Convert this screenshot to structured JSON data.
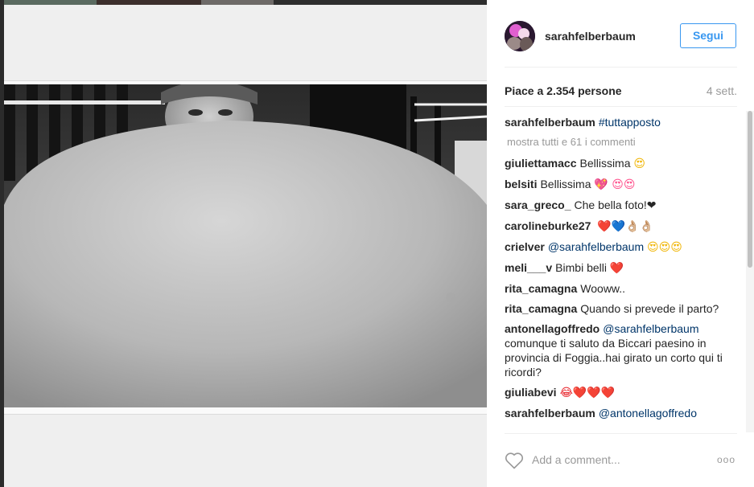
{
  "post": {
    "photo_alt": "Black and white photo",
    "author": "sarahfelberbaum",
    "follow_label": "Segui",
    "likes_text": "Piace a 2.354 persone",
    "time": "4 sett.",
    "caption": {
      "user": "sarahfelberbaum",
      "text": "#tuttapposto"
    },
    "load_more": "mostra tutti e 61 i commenti"
  },
  "comments": [
    {
      "user": "giuliettamacc",
      "text": "Bellissima",
      "emoji": "😍"
    },
    {
      "user": "belsiti",
      "text": "Bellissima",
      "emoji": "💖 😍😍"
    },
    {
      "user": "sara_greco_",
      "text": "Che bella foto!❤",
      "emoji": ""
    },
    {
      "user": "carolineburke27",
      "text": "",
      "emoji": "❤️💙👌🏼👌🏼"
    },
    {
      "user": "crielver",
      "mention": "@sarahfelberbaum",
      "text": "",
      "emoji": "😍😍😍"
    },
    {
      "user": "meli___v",
      "text": "Bimbi belli",
      "emoji": "❤️"
    },
    {
      "user": "rita_camagna",
      "text": "Wooww..",
      "emoji": ""
    },
    {
      "user": "rita_camagna",
      "text": "Quando si prevede il parto?",
      "emoji": ""
    },
    {
      "user": "antonellagoffredo",
      "mention": "@sarahfelberbaum",
      "text": "comunque ti saluto da Biccari paesino in provincia di Foggia..hai girato un corto qui ti ricordi?",
      "emoji": ""
    },
    {
      "user": "giuliabevi",
      "text": "",
      "emoji": "😂❤️❤️❤️"
    },
    {
      "user": "sarahfelberbaum",
      "mention": "@antonellagoffredo",
      "text": "",
      "emoji": ""
    }
  ],
  "footer": {
    "comment_placeholder": "Add a comment...",
    "more_label": "ooo"
  },
  "icons": {
    "like": "heart-outline-icon",
    "more": "ellipsis-icon"
  },
  "colors": {
    "accent": "#3897f0",
    "mention": "#003569"
  }
}
